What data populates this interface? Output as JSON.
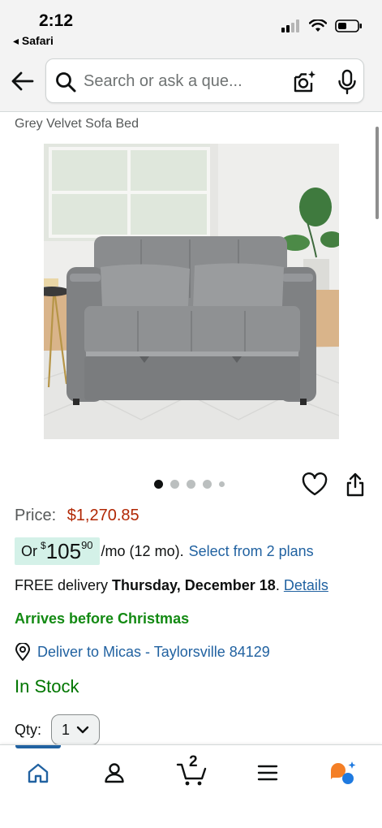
{
  "status_bar": {
    "time": "2:12",
    "back_app": "◂ Safari"
  },
  "search": {
    "placeholder": "Search or ask a que..."
  },
  "product": {
    "title": "Grey Velvet Sofa Bed",
    "image_icon": "sofa-bed-photo",
    "carousel_total": 5,
    "carousel_active": 1
  },
  "price": {
    "label": "Price:",
    "value": "$1,270.85"
  },
  "monthly": {
    "or": "Or",
    "currency": "$",
    "dollars": "105",
    "cents": "90",
    "term": "/mo (12 mo).",
    "plans_link": "Select from 2 plans"
  },
  "delivery": {
    "prefix": "FREE delivery",
    "date": "Thursday, December 18",
    "period": ".",
    "details_link": "Details"
  },
  "arrives": "Arrives before Christmas",
  "deliver_to": "Deliver to Micas - Taylorsville 84129",
  "stock": "In Stock",
  "qty": {
    "label": "Qty:",
    "value": "1"
  },
  "cart": {
    "count": "2"
  },
  "colors": {
    "price": "#b12704",
    "link": "#2162a1",
    "green": "#138a13",
    "stock": "#007600",
    "nav_active": "#2162a1"
  },
  "nav": {
    "items": [
      "home-icon",
      "account-icon",
      "cart-icon",
      "menu-icon",
      "rufus-ai-icon"
    ]
  }
}
